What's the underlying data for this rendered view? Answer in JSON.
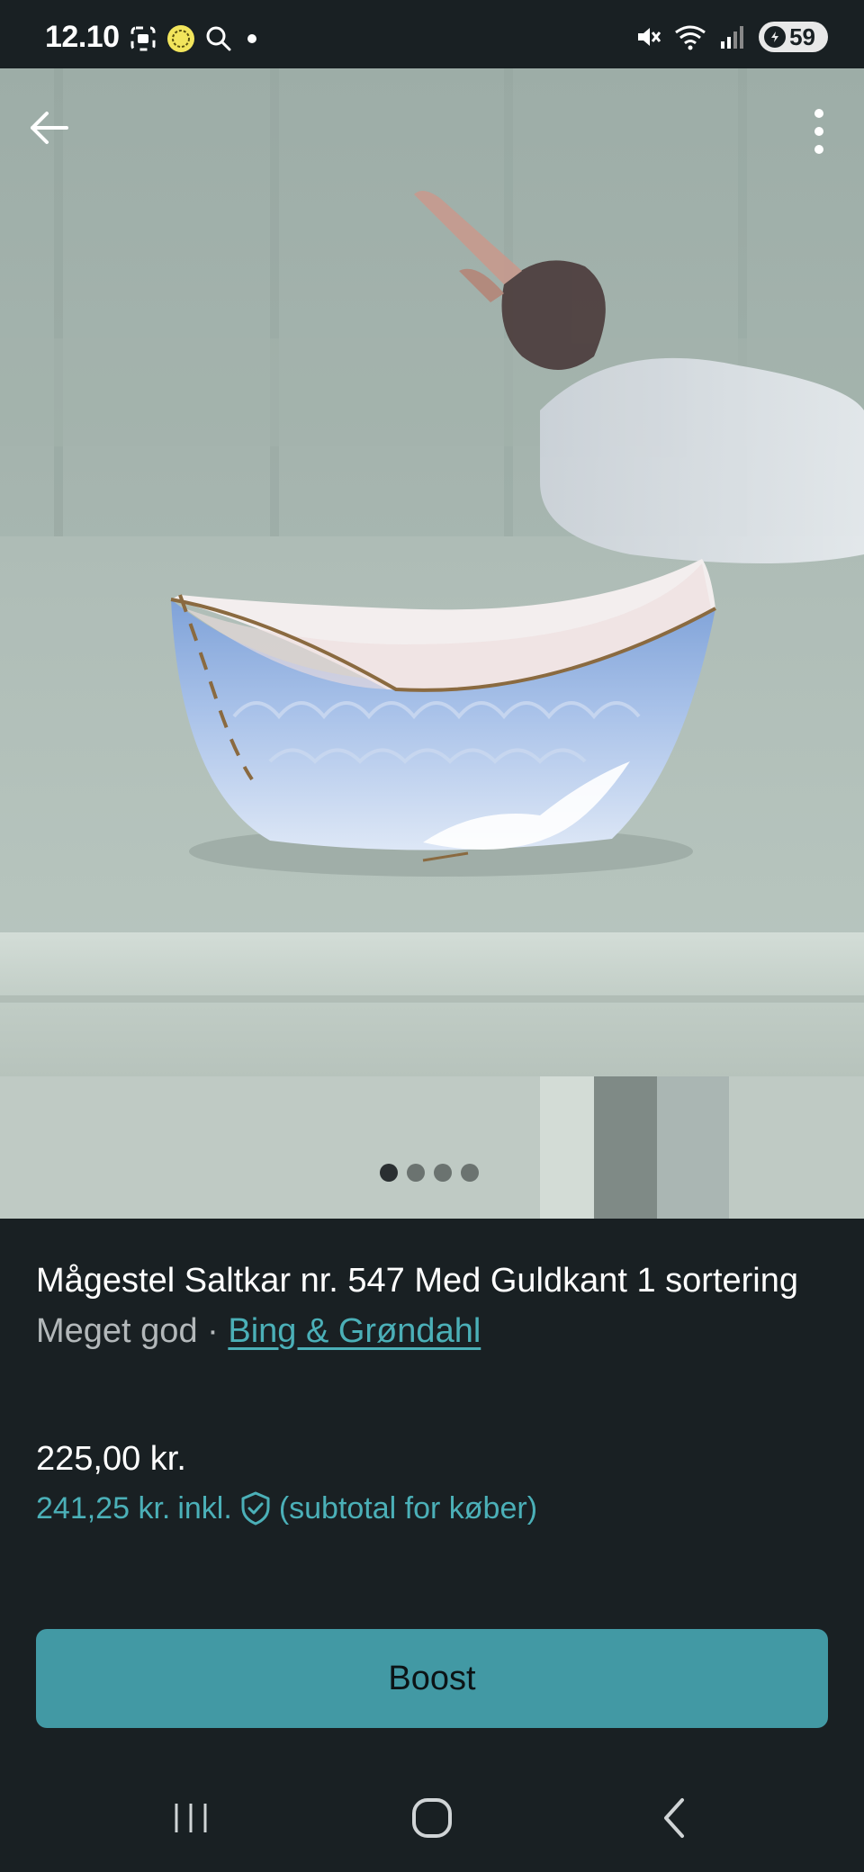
{
  "status_bar": {
    "time": "12.10",
    "battery_level": "59",
    "icons": [
      "screenshot-icon",
      "app-badge-icon",
      "search-icon",
      "notification-dot-icon",
      "mute-icon",
      "wifi-icon",
      "signal-icon",
      "battery-icon"
    ]
  },
  "gallery": {
    "image_count": 4,
    "active_index": 0,
    "back_icon": "back-arrow-icon",
    "more_icon": "more-vertical-icon"
  },
  "listing": {
    "title": "Mågestel Saltkar nr. 547 Med Guldkant 1 sortering",
    "condition": "Meget god",
    "separator": " · ",
    "brand": "Bing & Grøndahl",
    "price": "225,00 kr.",
    "price_incl_amount": "241,25 kr.",
    "price_incl_word": "inkl.",
    "price_incl_note": "(subtotal for køber)"
  },
  "actions": {
    "boost_label": "Boost"
  },
  "navigation": {
    "icons": [
      "recent-apps-icon",
      "home-icon",
      "back-icon"
    ]
  },
  "colors": {
    "background": "#192023",
    "accent": "#4bb0b8",
    "button": "#4299a4"
  }
}
